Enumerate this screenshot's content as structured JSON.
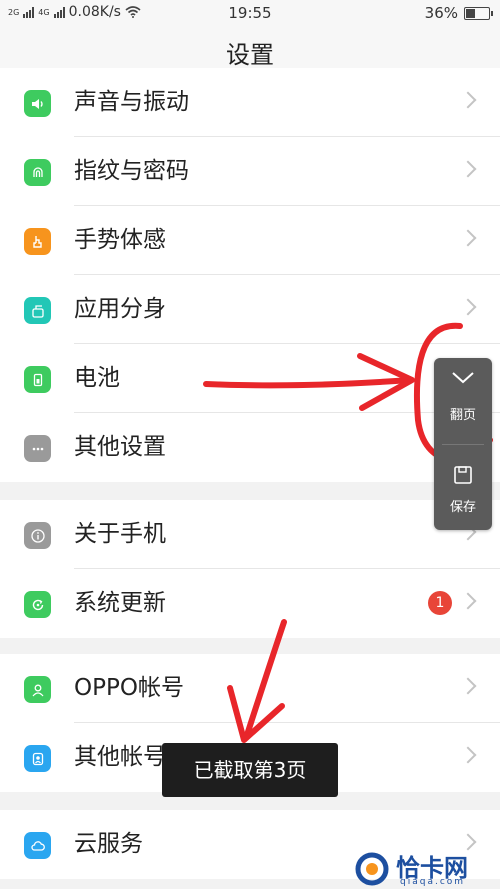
{
  "status_bar": {
    "network_left": "2G",
    "network_right": "4G",
    "speed": "0.08K/s",
    "time": "19:55",
    "battery_percent": "36%",
    "battery_level": 0.36
  },
  "header": {
    "title": "设置"
  },
  "groups": [
    {
      "items": [
        {
          "label": "声音与振动",
          "icon": "speaker-icon",
          "color": "#3ecb5f"
        },
        {
          "label": "指纹与密码",
          "icon": "fingerprint-icon",
          "color": "#3ecb5f"
        },
        {
          "label": "手势体感",
          "icon": "hand-gesture-icon",
          "color": "#f7941d"
        },
        {
          "label": "应用分身",
          "icon": "app-clone-icon",
          "color": "#22c7b6"
        },
        {
          "label": "电池",
          "icon": "battery-icon",
          "color": "#3ecb5f"
        },
        {
          "label": "其他设置",
          "icon": "more-dots-icon",
          "color": "#9a9a9a"
        }
      ]
    },
    {
      "items": [
        {
          "label": "关于手机",
          "icon": "info-icon",
          "color": "#9a9a9a"
        },
        {
          "label": "系统更新",
          "icon": "update-icon",
          "color": "#3ecb5f",
          "badge": "1"
        }
      ]
    },
    {
      "items": [
        {
          "label": "OPPO帐号",
          "icon": "account-icon",
          "color": "#3ecb5f"
        },
        {
          "label": "其他帐号",
          "icon": "user-icon",
          "color": "#2aa6f0"
        }
      ]
    },
    {
      "items": [
        {
          "label": "云服务",
          "icon": "cloud-icon",
          "color": "#2aa6f0"
        }
      ]
    }
  ],
  "float_panel": {
    "page_turn_label": "翻页",
    "save_label": "保存"
  },
  "toast": {
    "text": "已截取第3页"
  },
  "watermark": {
    "name": "恰卡网",
    "domain": "qiaqa.com"
  },
  "colors": {
    "annotation_red": "#e8262a",
    "badge": "#e84538"
  }
}
